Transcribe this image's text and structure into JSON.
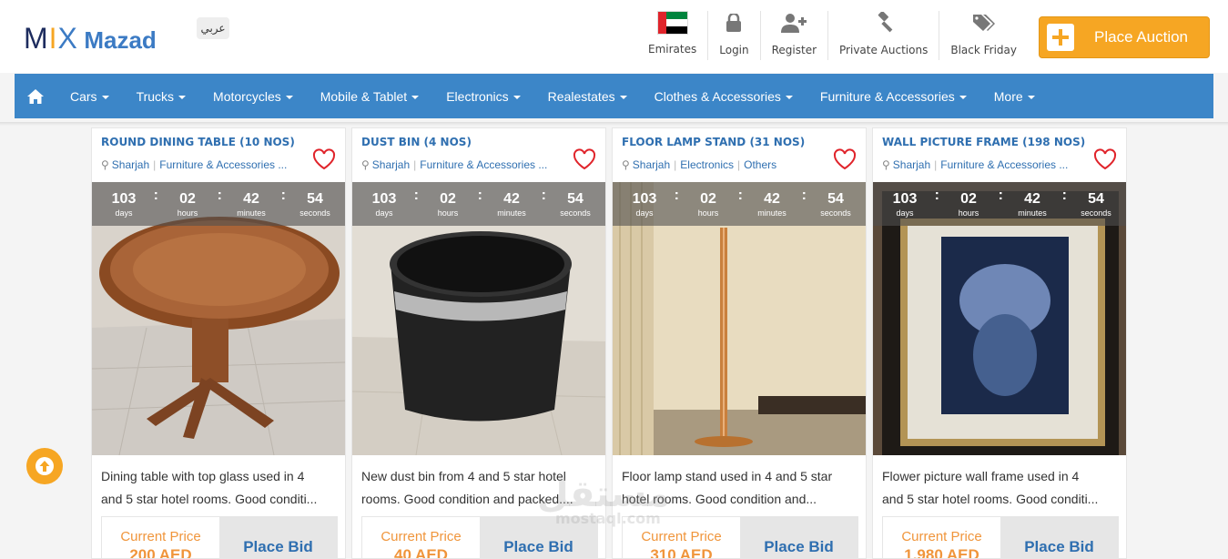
{
  "header": {
    "logo_mix_m": "M",
    "logo_mix_i": "I",
    "logo_mix_x": "X",
    "logo_mazad": "Mazad",
    "lang_label": "عربي",
    "topnav": {
      "emirates": "Emirates",
      "login": "Login",
      "register": "Register",
      "private_auctions": "Private Auctions",
      "black_friday": "Black Friday"
    },
    "place_auction": "Place Auction"
  },
  "navbar": {
    "items": [
      "Cars",
      "Trucks",
      "Motorcycles",
      "Mobile & Tablet",
      "Electronics",
      "Realestates",
      "Clothes & Accessories",
      "Furniture & Accessories",
      "More"
    ]
  },
  "timer_units": {
    "days": "days",
    "hours": "hours",
    "minutes": "minutes",
    "seconds": "seconds"
  },
  "cards": [
    {
      "title": "ROUND DINING TABLE (10 NOS)",
      "location": "Sharjah",
      "category": "Furniture & Accessories ...",
      "timer": {
        "days": "103",
        "hours": "02",
        "minutes": "42",
        "seconds": "54"
      },
      "desc_line1": "Dining table with top glass used in 4",
      "desc_line2": "and 5 star hotel rooms. Good conditi...",
      "price_label": "Current Price",
      "price": "200 AED",
      "bid_label": "Place Bid"
    },
    {
      "title": "DUST BIN (4 NOS)",
      "location": "Sharjah",
      "category": "Furniture & Accessories ...",
      "timer": {
        "days": "103",
        "hours": "02",
        "minutes": "42",
        "seconds": "54"
      },
      "desc_line1": "New dust bin from 4 and 5 star hotel",
      "desc_line2": "rooms. Good condition and packed....",
      "price_label": "Current Price",
      "price": "40 AED",
      "bid_label": "Place Bid"
    },
    {
      "title": "FLOOR LAMP STAND (31 NOS)",
      "location": "Sharjah",
      "category": "Electronics",
      "category2": "Others",
      "timer": {
        "days": "103",
        "hours": "02",
        "minutes": "42",
        "seconds": "54"
      },
      "desc_line1": "Floor lamp stand used in 4 and 5 star",
      "desc_line2": "hotel rooms. Good condition and...",
      "price_label": "Current Price",
      "price": "310 AED",
      "bid_label": "Place Bid"
    },
    {
      "title": "WALL PICTURE FRAME (198 NOS)",
      "location": "Sharjah",
      "category": "Furniture & Accessories ...",
      "timer": {
        "days": "103",
        "hours": "02",
        "minutes": "42",
        "seconds": "54"
      },
      "desc_line1": "Flower picture wall frame used in 4",
      "desc_line2": "and 5 star hotel rooms. Good conditi...",
      "price_label": "Current Price",
      "price": "1,980 AED",
      "bid_label": "Place Bid"
    }
  ],
  "watermark": {
    "ar": "مستقل",
    "en": "mostaql.com"
  },
  "colors": {
    "accent": "#f6a623",
    "nav": "#3c86c8",
    "link": "#2f6fb0",
    "heart": "#e0242b"
  }
}
